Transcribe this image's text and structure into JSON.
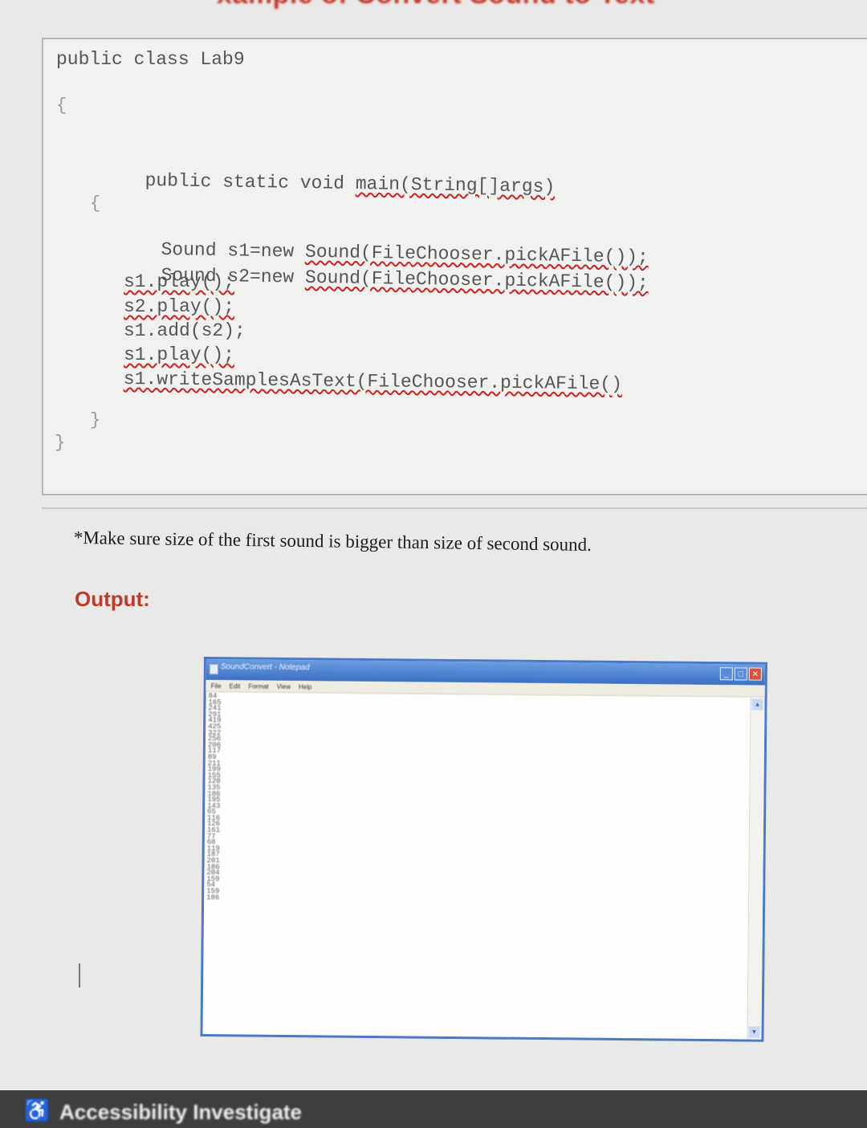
{
  "heading": {
    "text": "xample of Convert Sound to Text"
  },
  "code": {
    "lines": [
      "public class Lab9",
      "{",
      "public static void main(String[]args)",
      "{",
      "Sound s1=new Sound(FileChooser.pickAFile());",
      "Sound s2=new Sound(FileChooser.pickAFile());",
      "s1.play();",
      "s2.play();",
      "s1.add(s2);",
      "s1.play();",
      "s1.writeSamplesAsText(FileChooser.pickAFile()",
      "}",
      "}"
    ]
  },
  "note": {
    "text": "*Make sure size of the first sound is bigger than size of second sound."
  },
  "output": {
    "label": "Output:"
  },
  "notepad": {
    "title": "SoundConvert - Notepad",
    "menu": [
      "File",
      "Edit",
      "Format",
      "View",
      "Help"
    ],
    "values": [
      "84",
      "165",
      "241",
      "291",
      "419",
      "425",
      "322",
      "256",
      "206",
      "117",
      "89",
      "211",
      "199",
      "155",
      "120",
      "135",
      "186",
      "195",
      "143",
      "65",
      "116",
      "126",
      "161",
      "77",
      "68",
      "119",
      "187",
      "201",
      "186",
      "204",
      "159",
      "54",
      "159",
      "186"
    ]
  },
  "footer": {
    "text": "Accessibility Investigate"
  }
}
